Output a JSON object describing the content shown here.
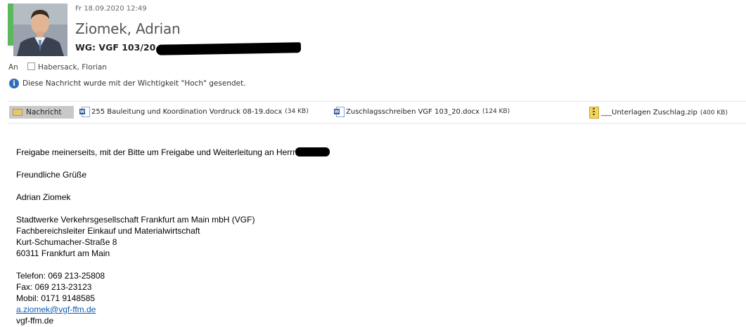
{
  "header": {
    "date": "Fr 18.09.2020 12:49",
    "sender": "Ziomek, Adrian",
    "subject": "WG: VGF 103/20",
    "accent_color": "#5cb85c"
  },
  "recipients": {
    "to_label": "An",
    "to_name": "Habersack, Florian"
  },
  "info_bar": {
    "icon": "info-icon",
    "text": "Diese Nachricht wurde mit der Wichtigkeit \"Hoch\" gesendet."
  },
  "attachments_bar": {
    "message_tab": "Nachricht",
    "items": [
      {
        "icon": "word-doc-icon",
        "name": "255 Bauleitung und Koordination Vordruck 08-19.docx",
        "size": "(34 KB)"
      },
      {
        "icon": "word-doc-icon",
        "name": "Zuschlagsschreiben VGF 103_20.docx",
        "size": "(124 KB)"
      },
      {
        "icon": "zip-icon",
        "name": "___Unterlagen Zuschlag.zip",
        "size": "(400 KB)"
      }
    ]
  },
  "body": {
    "line1": "Freigabe meinerseits, mit der Bitte um Freigabe und Weiterleitung an Herrn",
    "greeting": "Freundliche Grüße",
    "name": "Adrian Ziomek",
    "company": "Stadtwerke Verkehrsgesellschaft Frankfurt am Main mbH (VGF)",
    "role": "Fachbereichsleiter Einkauf und Materialwirtschaft",
    "street": "Kurt-Schumacher-Straße 8",
    "city": "60311 Frankfurt am Main",
    "phone": "Telefon: 069 213-25808",
    "fax": "Fax: 069 213-23123",
    "mobile": "Mobil: 0171 9148585",
    "email": "a.ziomek@vgf-ffm.de",
    "website": "vgf-ffm.de",
    "link_color": "#0b5db3"
  }
}
